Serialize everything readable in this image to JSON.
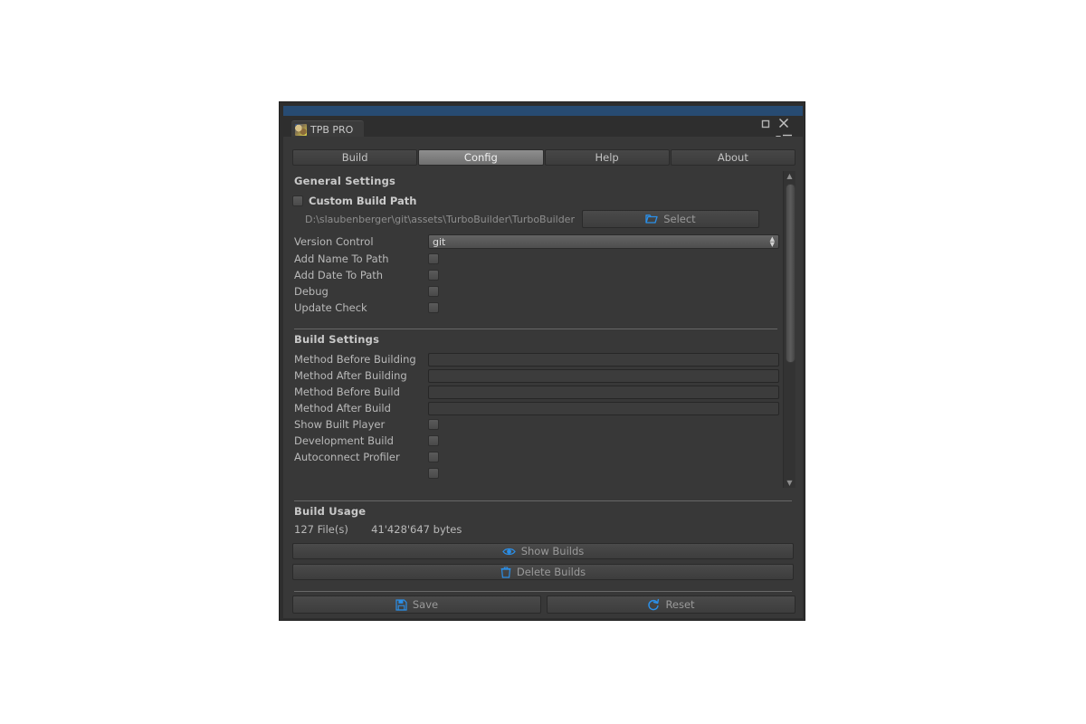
{
  "window": {
    "tab_title": "TPB PRO",
    "tab_icon": "app-thumbnail-icon",
    "controls": {
      "maximize": "maximize-icon",
      "close": "close-icon",
      "menu": "context-menu-icon"
    }
  },
  "tabs": [
    {
      "label": "Build",
      "active": false
    },
    {
      "label": "Config",
      "active": true
    },
    {
      "label": "Help",
      "active": false
    },
    {
      "label": "About",
      "active": false
    }
  ],
  "general_settings": {
    "title": "General Settings",
    "custom_build_path": {
      "label": "Custom Build Path",
      "checked": false
    },
    "path_value": "D:\\slaubenberger\\git\\assets\\TurboBuilder\\TurboBuilder",
    "select_button": "Select",
    "version_control": {
      "label": "Version Control",
      "value": "git"
    },
    "toggles": [
      {
        "label": "Add Name To Path",
        "checked": false
      },
      {
        "label": "Add Date To Path",
        "checked": false
      },
      {
        "label": "Debug",
        "checked": false
      },
      {
        "label": "Update Check",
        "checked": false
      }
    ]
  },
  "build_settings": {
    "title": "Build Settings",
    "fields": [
      {
        "label": "Method Before Building",
        "value": "",
        "placeholder": ""
      },
      {
        "label": "Method After Building",
        "value": "",
        "placeholder": ""
      },
      {
        "label": "Method Before Build",
        "value": "",
        "placeholder": ""
      },
      {
        "label": "Method After Build",
        "value": "",
        "placeholder": ""
      }
    ],
    "toggles": [
      {
        "label": "Show Built Player",
        "checked": false
      },
      {
        "label": "Development Build",
        "checked": false
      },
      {
        "label": "Autoconnect Profiler",
        "checked": false
      }
    ]
  },
  "build_usage": {
    "title": "Build Usage",
    "file_count": "127 File(s)",
    "byte_size": "41'428'647 bytes",
    "show_builds": "Show Builds",
    "delete_builds": "Delete Builds"
  },
  "footer": {
    "save": "Save",
    "reset": "Reset"
  },
  "colors": {
    "accent_blue": "#2b8fe8",
    "panel_bg": "#383838",
    "titlebar_blue": "#274b72"
  }
}
